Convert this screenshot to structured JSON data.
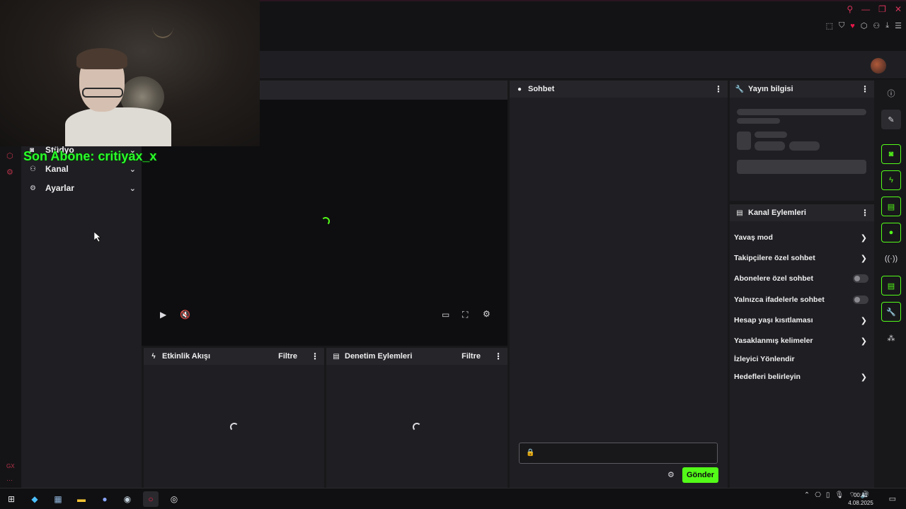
{
  "webcam_overlay": {
    "text": "Son Abone: critiyax_x"
  },
  "sidebar": {
    "items": [
      {
        "label": "Stüdyo",
        "icon": "camera-icon"
      },
      {
        "label": "Kanal",
        "icon": "users-icon"
      },
      {
        "label": "Ayarlar",
        "icon": "gear-icon"
      }
    ]
  },
  "panels": {
    "activity_feed": {
      "title": "Etkinlik Akışı",
      "filter": "Filtre"
    },
    "moderation": {
      "title": "Denetim Eylemleri",
      "filter": "Filtre"
    },
    "chat": {
      "title": "Sohbet",
      "send_label": "Gönder"
    },
    "stream_info": {
      "title": "Yayın bilgisi"
    },
    "channel_actions": {
      "title": "Kanal Eylemleri",
      "rows": [
        {
          "label": "Yavaş mod",
          "control": "chevron"
        },
        {
          "label": "Takipçilere özel sohbet",
          "control": "chevron"
        },
        {
          "label": "Abonelere özel sohbet",
          "control": "toggle",
          "enabled": false
        },
        {
          "label": "Yalnızca ifadelerle sohbet",
          "control": "toggle",
          "enabled": false
        },
        {
          "label": "Hesap yaşı kısıtlaması",
          "control": "chevron"
        },
        {
          "label": "Yasaklanmış kelimeler",
          "control": "chevron"
        },
        {
          "label": "İzleyici Yönlendir",
          "control": "none"
        },
        {
          "label": "Hedefleri belirleyin",
          "control": "chevron"
        }
      ]
    }
  },
  "taskbar": {
    "time": "00:41",
    "date": "4.08.2025"
  },
  "left_rail": {
    "bottom_text": "GX"
  },
  "colors": {
    "accent": "#53fc18",
    "browser_accent": "#d6335a",
    "background": "#18181a",
    "panel": "#1f1f23"
  }
}
